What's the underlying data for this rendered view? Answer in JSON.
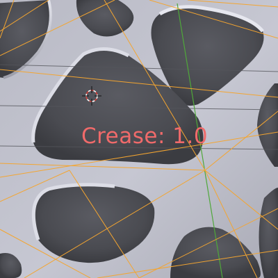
{
  "viewport": {
    "operator_text": "Crease: 1.0",
    "cursor_icon": "3d-cursor-icon",
    "colors": {
      "background": "#6d6e76",
      "surface_light": "#c3c4cf",
      "surface_mid": "#9a9ba6",
      "hole_dark": "#4f5056",
      "hole_deep": "#3b3c41",
      "wire_edge": "#f4a530",
      "grid_line": "#55565c",
      "y_axis": "#4fa83a",
      "label_text": "#f06a6a",
      "cursor_ring_red": "#d8403a",
      "cursor_ring_white": "#ffffff"
    }
  }
}
